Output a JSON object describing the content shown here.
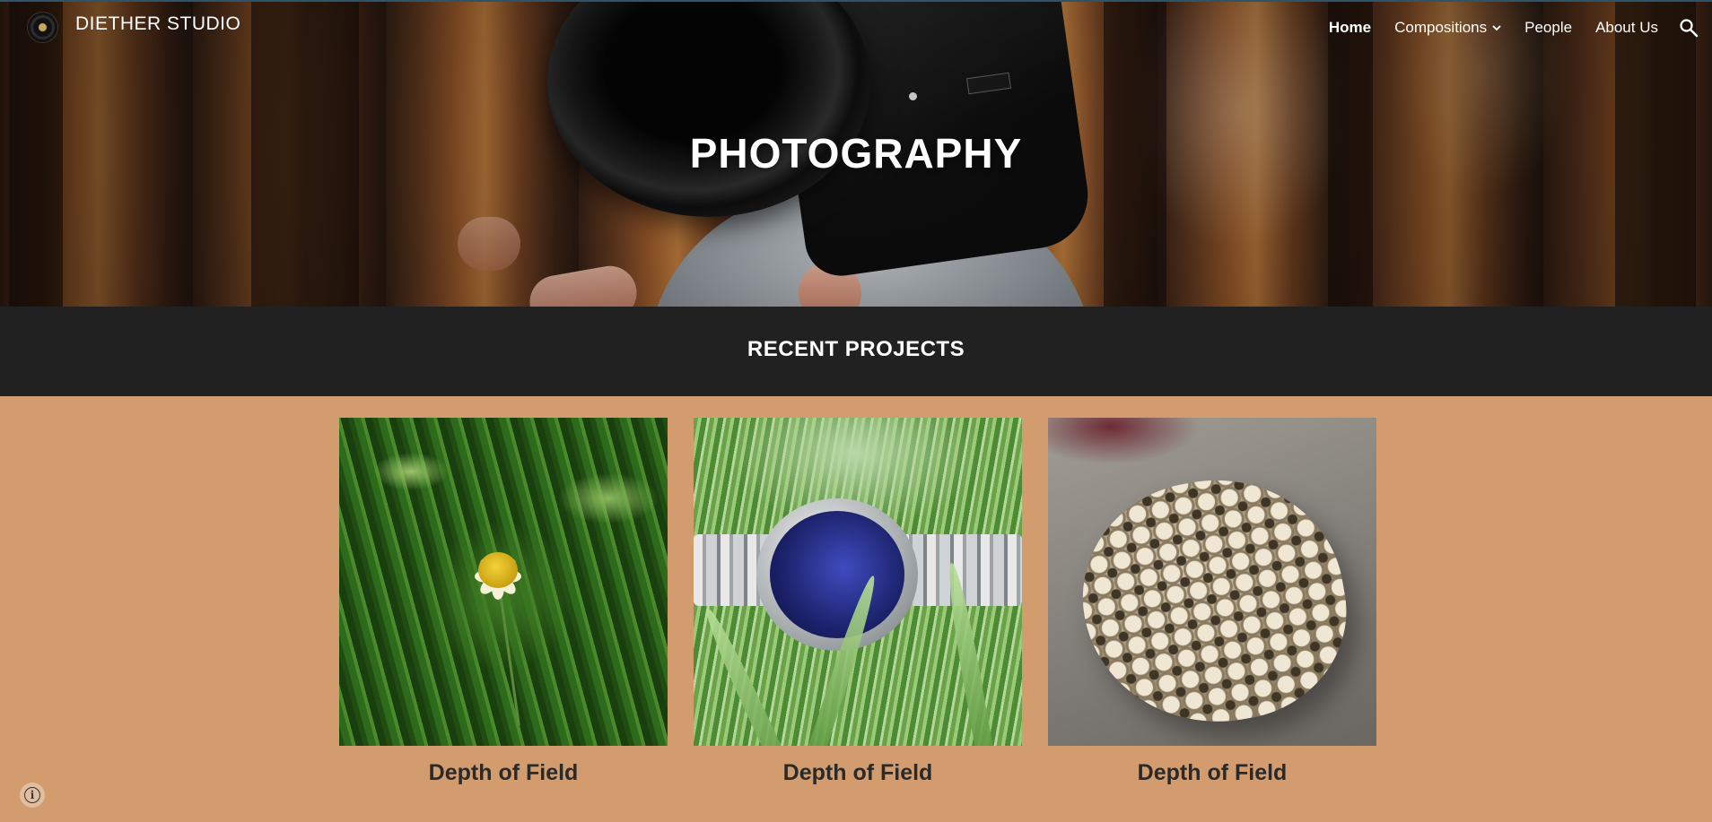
{
  "site": {
    "title": "DIETHER STUDIO",
    "logo_icon": "camera-lens-logo"
  },
  "nav": {
    "items": [
      {
        "label": "Home",
        "active": true
      },
      {
        "label": "Compositions",
        "has_dropdown": true
      },
      {
        "label": "People"
      },
      {
        "label": "About Us"
      }
    ],
    "search_icon": "search-icon"
  },
  "hero": {
    "title": "PHOTOGRAPHY"
  },
  "section": {
    "title": "RECENT PROJECTS"
  },
  "projects": [
    {
      "title": "Depth of Field",
      "image": "yellow-flower-in-grass"
    },
    {
      "title": "Depth of Field",
      "image": "wristwatch-in-grass"
    },
    {
      "title": "Depth of Field",
      "image": "coral-fossil-on-rock"
    }
  ],
  "footer": {
    "info_icon": "info-icon"
  },
  "colors": {
    "page_background": "#d39c6f",
    "band_background": "#212121",
    "card_title": "#2a2a2a",
    "nav_text": "#ffffff"
  }
}
